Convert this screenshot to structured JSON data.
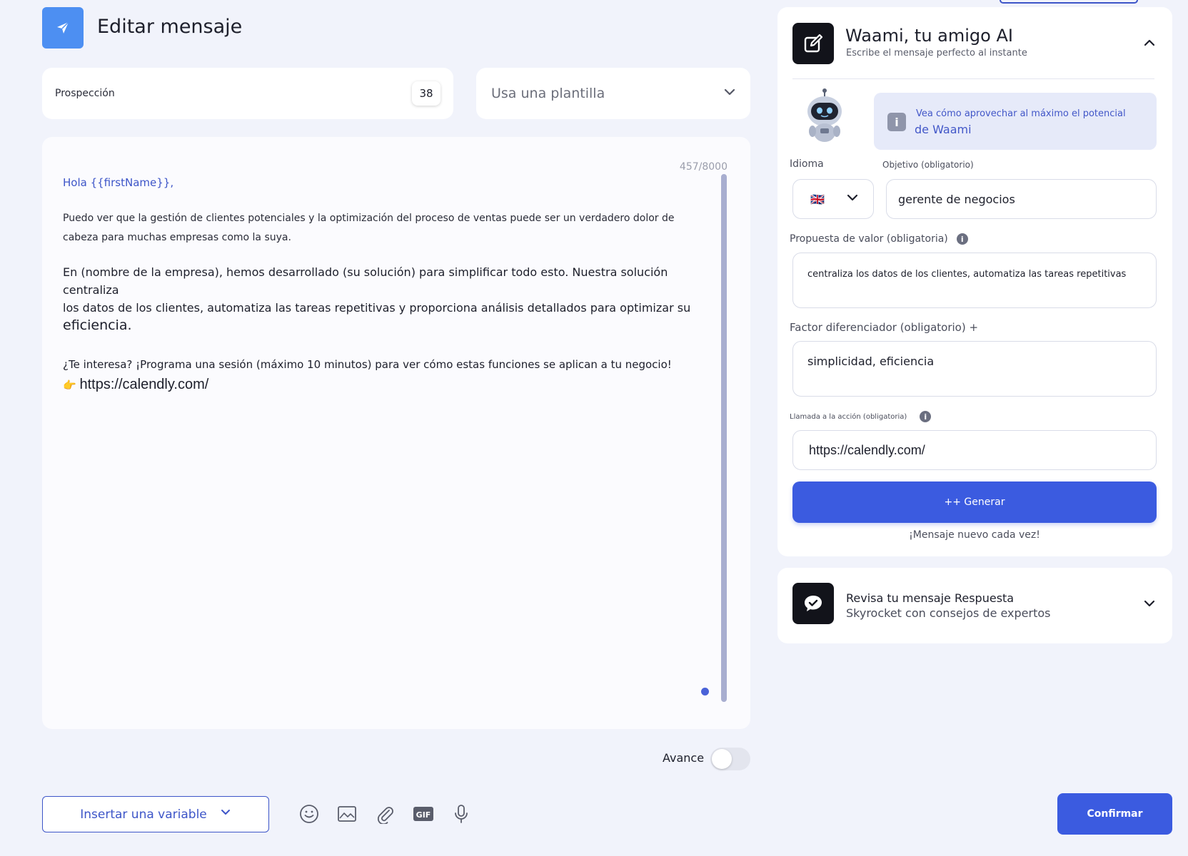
{
  "header": {
    "title": "Editar mensaje",
    "icon": "paper-plane-icon"
  },
  "sequence": {
    "label": "Prospección",
    "count": "38"
  },
  "template_select": {
    "placeholder": "Usa una plantilla"
  },
  "editor": {
    "counter": "457/8000",
    "greeting": "Hola {{firstName}},",
    "paragraph1": "Puedo ver que la gestión de clientes potenciales y la optimización del proceso de ventas puede ser un verdadero dolor de cabeza para muchas empresas como la suya.",
    "paragraph2_a": "En (nombre de la empresa), hemos desarrollado (su solución) para simplificar todo esto. Nuestra solución centraliza",
    "paragraph2_b": " los datos de los clientes, automatiza las tareas repetitivas y proporciona análisis detallados para optimizar su",
    "paragraph2_c": "eficiencia.",
    "paragraph3": "¿Te interesa? ¡Programa una sesión (máximo 10 minutos) para ver cómo estas funciones se aplican a tu negocio!",
    "link_emoji": "👉",
    "link": "https://calendly.com/"
  },
  "preview_toggle": {
    "label": "Avance",
    "on": false
  },
  "toolbar": {
    "insert_variable": "Insertar una variable",
    "gif_label": "GIF",
    "icons": [
      "emoji-icon",
      "image-icon",
      "attachment-icon",
      "gif-icon",
      "microphone-icon"
    ]
  },
  "confirm_label": "Confirmar",
  "ai_panel": {
    "title": "Waami, tu amigo AI",
    "subtitle": "Escribe el mensaje perfecto al instante",
    "info_line1": "Vea cómo aprovechar al máximo el potencial",
    "info_line2": "de Waami",
    "language_label": "Idioma",
    "language_flag": "🇬🇧",
    "objective_label": "Objetivo (obligatorio)",
    "objective_value": "gerente de negocios",
    "value_prop_label": "Propuesta de valor (obligatoria)",
    "value_prop_value": "centraliza los datos de los clientes, automatiza las tareas repetitivas",
    "differentiator_label": "Factor diferenciador (obligatorio) +",
    "differentiator_value": "simplicidad, eficiencia",
    "cta_label": "Llamada a la acción (obligatoria)",
    "cta_value": "https://calendly.com/",
    "generate_label": "++ Generar",
    "generate_sub": "¡Mensaje nuevo cada vez!"
  },
  "review_panel": {
    "title": "Revisa tu mensaje Respuesta",
    "subtitle": "Skyrocket con consejos de expertos"
  },
  "colors": {
    "primary": "#3b5be0",
    "accent_icon": "#4d8ff2",
    "link_text": "#3d55c8",
    "background": "#f1f3fb"
  }
}
